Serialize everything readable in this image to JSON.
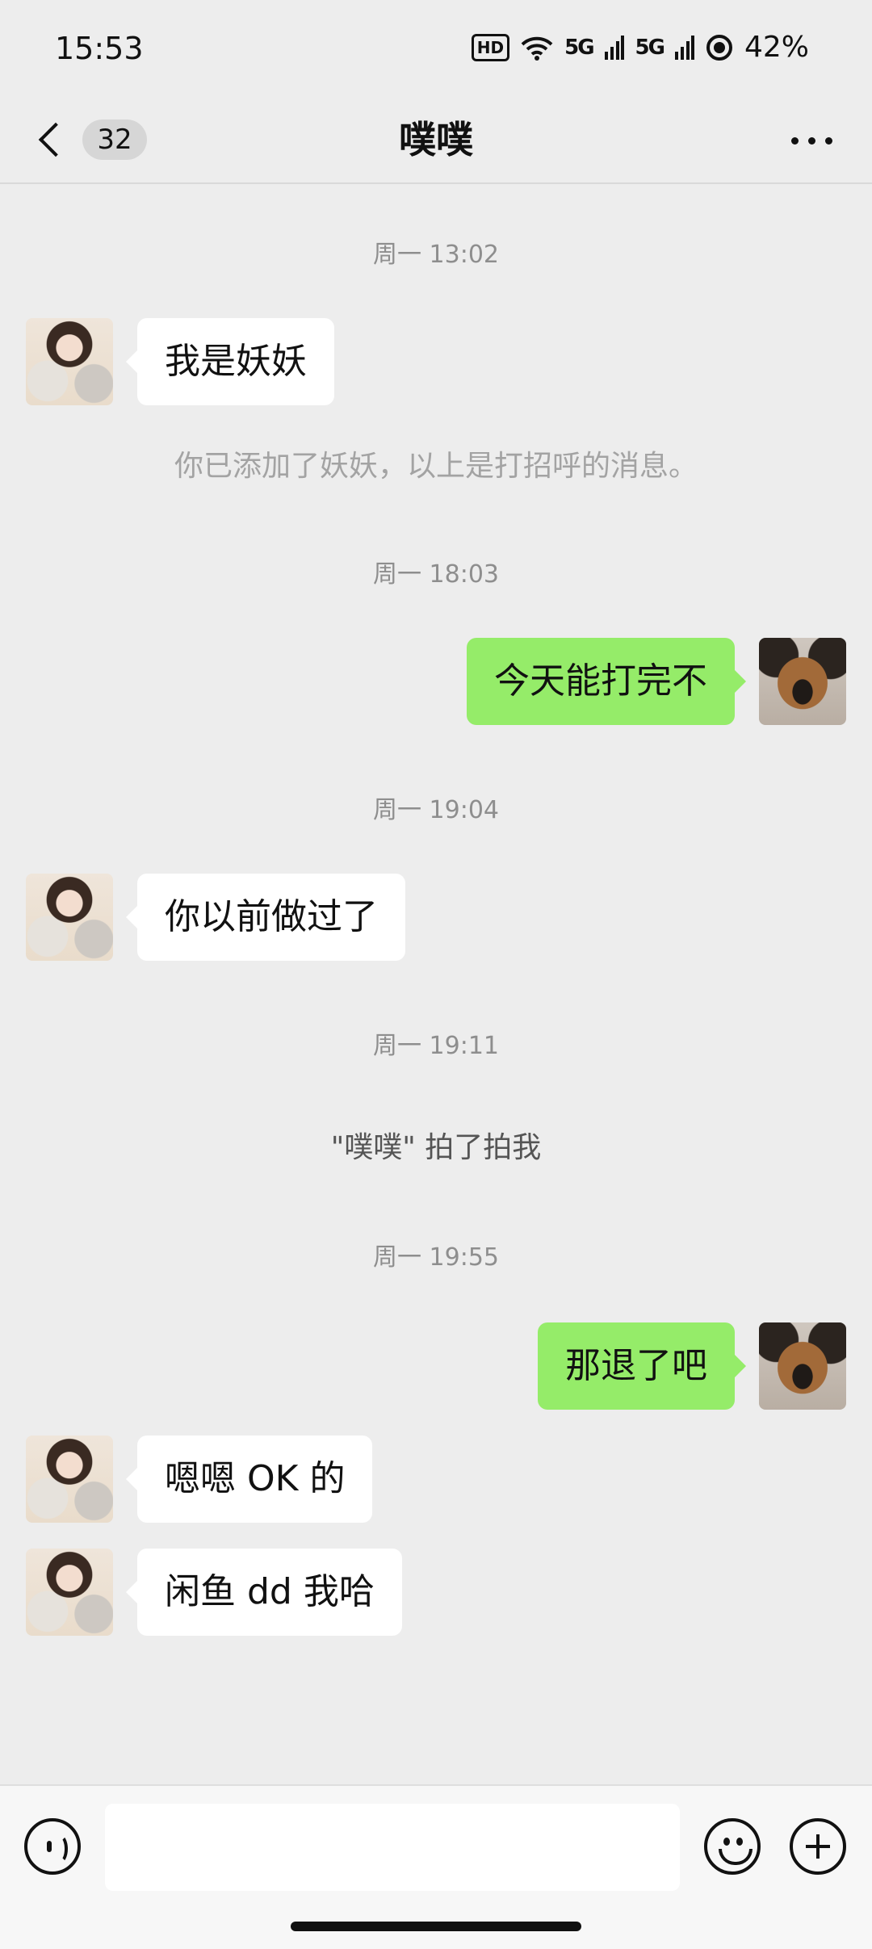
{
  "status_bar": {
    "time": "15:53",
    "hd_label": "HD",
    "signal1": "5G",
    "signal2": "5G",
    "battery": "42%"
  },
  "header": {
    "back_badge": "32",
    "title": "噗噗"
  },
  "chat": {
    "ts1": "周一 13:02",
    "msg1": "我是妖妖",
    "sys1": "你已添加了妖妖，以上是打招呼的消息。",
    "ts2": "周一 18:03",
    "msg2": "今天能打完不",
    "ts3": "周一 19:04",
    "msg3": "你以前做过了",
    "ts4": "周一 19:11",
    "sys2": "\"噗噗\" 拍了拍我",
    "ts5": "周一 19:55",
    "msg4": "那退了吧",
    "msg5": "嗯嗯 OK 的",
    "msg6": "闲鱼 dd 我哈"
  },
  "input": {
    "value": "",
    "placeholder": ""
  },
  "colors": {
    "background": "#ededed",
    "outgoing_bubble": "#95ec69",
    "incoming_bubble": "#ffffff"
  }
}
